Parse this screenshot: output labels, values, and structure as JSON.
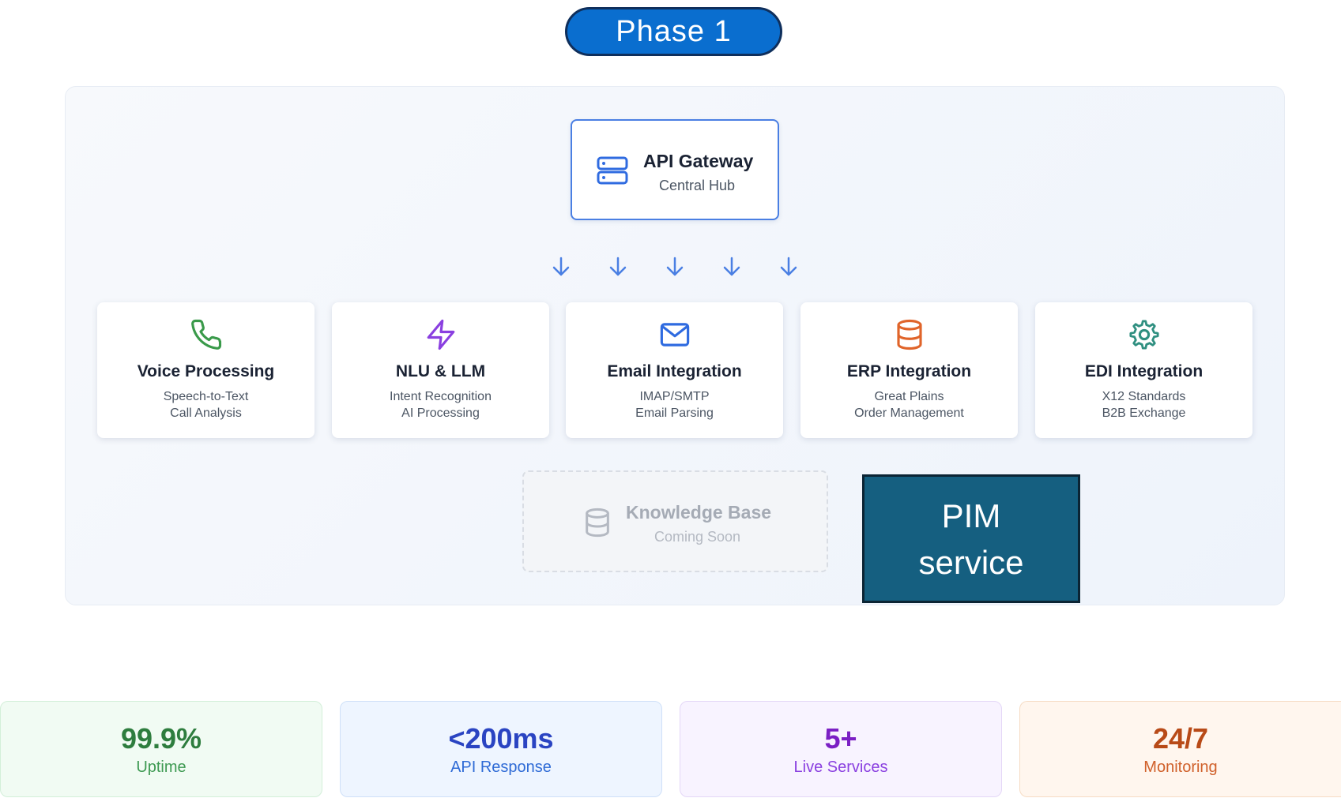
{
  "phase": {
    "label": "Phase 1"
  },
  "gateway": {
    "title": "API Gateway",
    "subtitle": "Central Hub",
    "icon": "server-icon"
  },
  "services": [
    {
      "title": "Voice Processing",
      "line1": "Speech-to-Text",
      "line2": "Call Analysis",
      "icon": "phone-icon",
      "color": "#3a9a4a"
    },
    {
      "title": "NLU & LLM",
      "line1": "Intent Recognition",
      "line2": "AI Processing",
      "icon": "lightning-icon",
      "color": "#8a3fe0"
    },
    {
      "title": "Email Integration",
      "line1": "IMAP/SMTP",
      "line2": "Email Parsing",
      "icon": "mail-icon",
      "color": "#2f6be0"
    },
    {
      "title": "ERP Integration",
      "line1": "Great Plains",
      "line2": "Order Management",
      "icon": "database-icon",
      "color": "#e0642a"
    },
    {
      "title": "EDI Integration",
      "line1": "X12 Standards",
      "line2": "B2B Exchange",
      "icon": "gear-icon",
      "color": "#2f8f80"
    }
  ],
  "knowledge_base": {
    "title": "Knowledge Base",
    "subtitle": "Coming Soon",
    "icon": "database-icon"
  },
  "pim": {
    "line1": "PIM",
    "line2": "service"
  },
  "stats": [
    {
      "value": "99.9%",
      "label": "Uptime",
      "bg": "#f1fbf3",
      "border": "#d3efd9",
      "color": "#2e7d3e",
      "label_color": "#3e9a52"
    },
    {
      "value": "<200ms",
      "label": "API Response",
      "bg": "#eef5ff",
      "border": "#cfe0f8",
      "color": "#2a44c2",
      "label_color": "#2f6bd6"
    },
    {
      "value": "5+",
      "label": "Live Services",
      "bg": "#f8f3ff",
      "border": "#e4d7f7",
      "color": "#7b1fc4",
      "label_color": "#8a3fe0"
    },
    {
      "value": "24/7",
      "label": "Monitoring",
      "bg": "#fff6ee",
      "border": "#f6dcc4",
      "color": "#b84a17",
      "label_color": "#d0602a"
    }
  ]
}
